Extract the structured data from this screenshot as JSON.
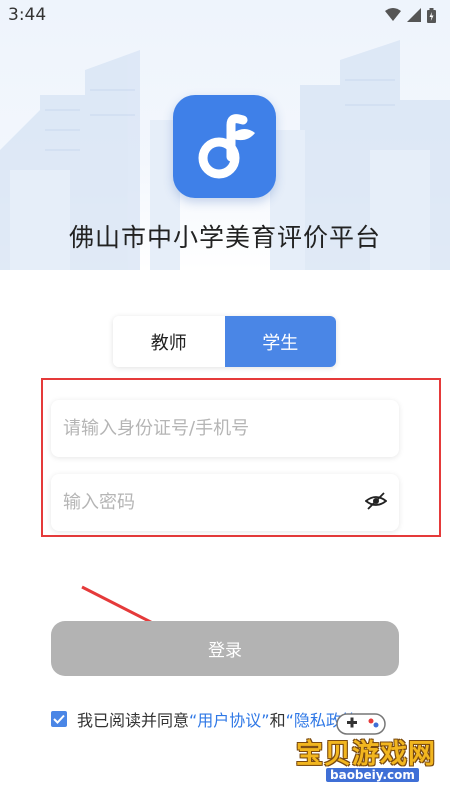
{
  "status_bar": {
    "time": "3:44"
  },
  "app": {
    "title": "佛山市中小学美育评价平台"
  },
  "role_tabs": [
    {
      "label": "教师",
      "active": false
    },
    {
      "label": "学生",
      "active": true
    }
  ],
  "form": {
    "id_placeholder": "请输入身份证号/手机号",
    "password_placeholder": "输入密码"
  },
  "login": {
    "label": "登录"
  },
  "agreement": {
    "prefix": "我已阅读并同意",
    "user_agreement": "“用户协议”",
    "and": "和",
    "privacy_policy": "“隐私政策”",
    "checked": true
  },
  "watermark": {
    "title": "宝贝游戏网",
    "url": "baobeiy.com"
  },
  "colors": {
    "accent": "#4a86e6",
    "login_disabled": "#b3b3b3",
    "highlight_border": "#e53a3a",
    "link": "#2f78e6"
  }
}
